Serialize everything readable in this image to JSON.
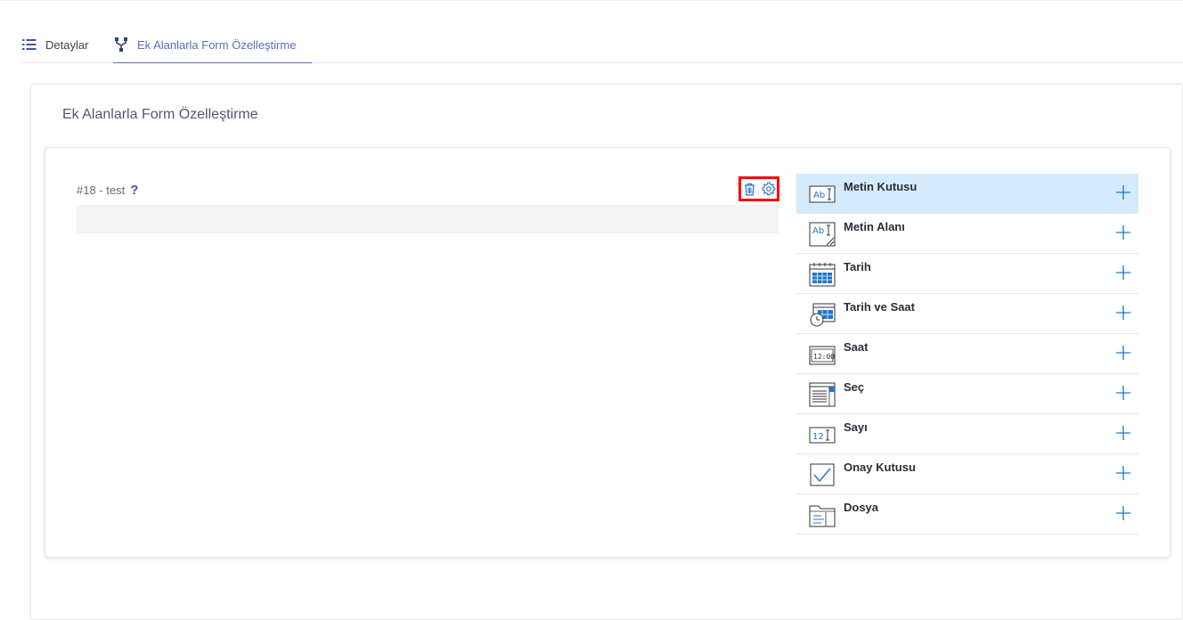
{
  "tabs": [
    {
      "label": "Detaylar",
      "icon": "list-icon",
      "active": false
    },
    {
      "label": "Ek Alanlarla Form Özelleştirme",
      "icon": "flow-icon",
      "active": true
    }
  ],
  "card": {
    "title": "Ek Alanlarla Form Özelleştirme"
  },
  "field": {
    "label": "#18 - test",
    "help": "?",
    "value": ""
  },
  "palette": {
    "items": [
      {
        "label": "Metin Kutusu",
        "icon": "text-box-icon"
      },
      {
        "label": "Metin Alanı",
        "icon": "text-area-icon"
      },
      {
        "label": "Tarih",
        "icon": "calendar-icon"
      },
      {
        "label": "Tarih ve Saat",
        "icon": "calendar-clock-icon"
      },
      {
        "label": "Saat",
        "icon": "time-icon"
      },
      {
        "label": "Seç",
        "icon": "select-list-icon"
      },
      {
        "label": "Sayı",
        "icon": "number-icon"
      },
      {
        "label": "Onay Kutusu",
        "icon": "checkbox-icon"
      },
      {
        "label": "Dosya",
        "icon": "file-icon"
      }
    ]
  },
  "colors": {
    "accent": "#5b6fb5",
    "highlight": "#d4ebfd",
    "action_frame": "#ff0000",
    "icon_blue": "#1f77c9"
  }
}
